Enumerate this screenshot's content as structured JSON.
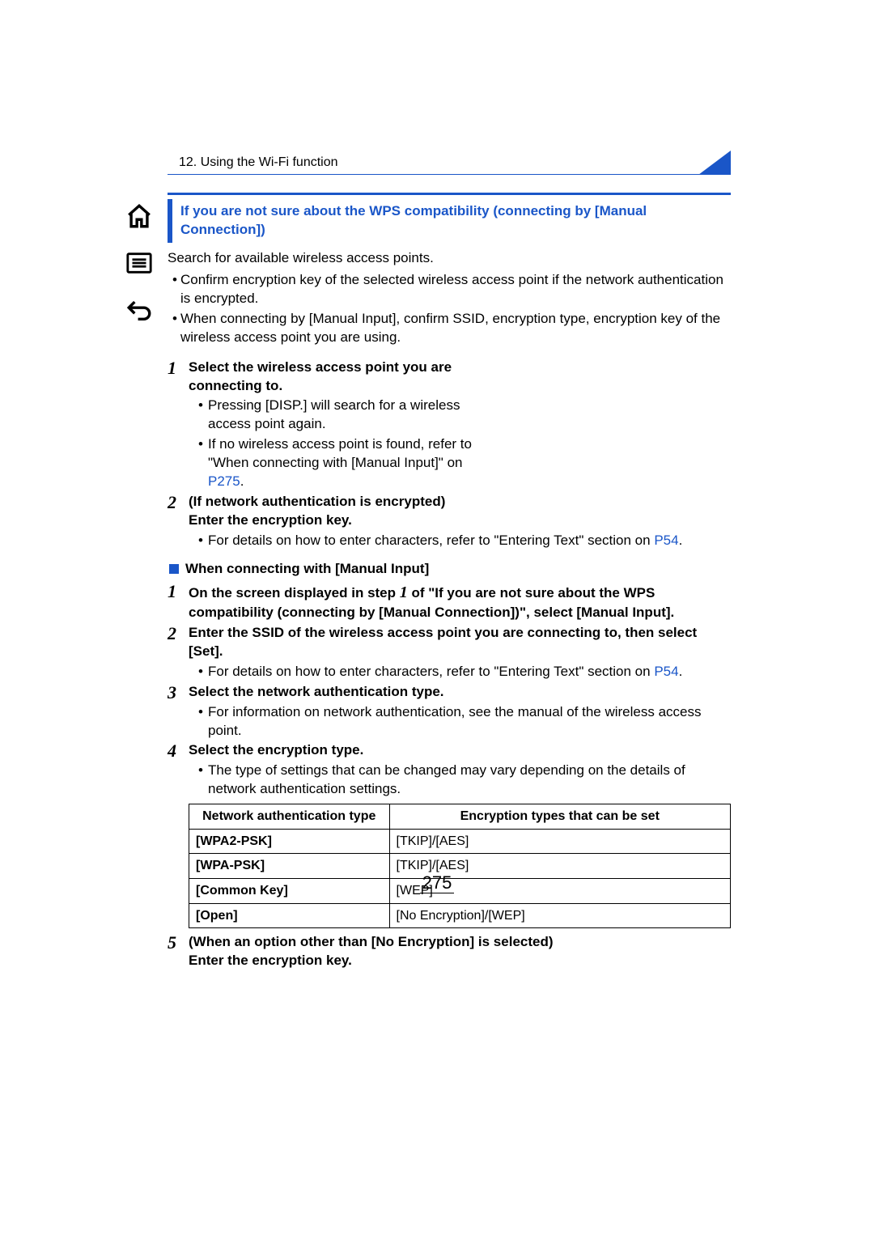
{
  "chapter": "12. Using the Wi-Fi function",
  "callout_title": "If you are not sure about the WPS compatibility (connecting by [Manual Connection])",
  "intro": "Search for available wireless access points.",
  "bullets": [
    "Confirm encryption key of the selected wireless access point if the network authentication is encrypted.",
    "When connecting by [Manual Input], confirm SSID, encryption type, encryption key of the wireless access point you are using."
  ],
  "steps_a": [
    {
      "num": "1",
      "title": "Select the wireless access point you are connecting to.",
      "subs": [
        {
          "text": "Pressing [DISP.] will search for a wireless access point again."
        },
        {
          "text_pre": "If no wireless access point is found, refer to \"When connecting with [Manual Input]\" on ",
          "link": "P275",
          "text_post": "."
        }
      ]
    },
    {
      "num": "2",
      "title_lines": [
        "(If network authentication is encrypted)",
        "Enter the encryption key."
      ],
      "subs": [
        {
          "text_pre": "For details on how to enter characters, refer to \"Entering Text\" section on ",
          "link": "P54",
          "text_post": "."
        }
      ]
    }
  ],
  "heading_b": "When connecting with [Manual Input]",
  "steps_b": [
    {
      "num": "1",
      "title_pre": "On the screen displayed in step ",
      "title_mid": "1",
      "title_post": " of \"If you are not sure about the WPS compatibility (connecting by [Manual Connection])\", select [Manual Input]."
    },
    {
      "num": "2",
      "title": "Enter the SSID of the wireless access point you are connecting to, then select [Set].",
      "subs": [
        {
          "text_pre": "For details on how to enter characters, refer to \"Entering Text\" section on ",
          "link": "P54",
          "text_post": "."
        }
      ]
    },
    {
      "num": "3",
      "title": "Select the network authentication type.",
      "subs": [
        {
          "text": "For information on network authentication, see the manual of the wireless access point."
        }
      ]
    },
    {
      "num": "4",
      "title": "Select the encryption type.",
      "subs": [
        {
          "text": "The type of settings that can be changed may vary depending on the details of network authentication settings."
        }
      ]
    }
  ],
  "table": {
    "headers": [
      "Network authentication type",
      "Encryption types that can be set"
    ],
    "rows": [
      [
        "[WPA2-PSK]",
        "[TKIP]/[AES]"
      ],
      [
        "[WPA-PSK]",
        "[TKIP]/[AES]"
      ],
      [
        "[Common Key]",
        "[WEP]"
      ],
      [
        "[Open]",
        "[No Encryption]/[WEP]"
      ]
    ]
  },
  "step5": {
    "num": "5",
    "lines": [
      "(When an option other than [No Encryption] is selected)",
      "Enter the encryption key."
    ]
  },
  "page_number": "275"
}
